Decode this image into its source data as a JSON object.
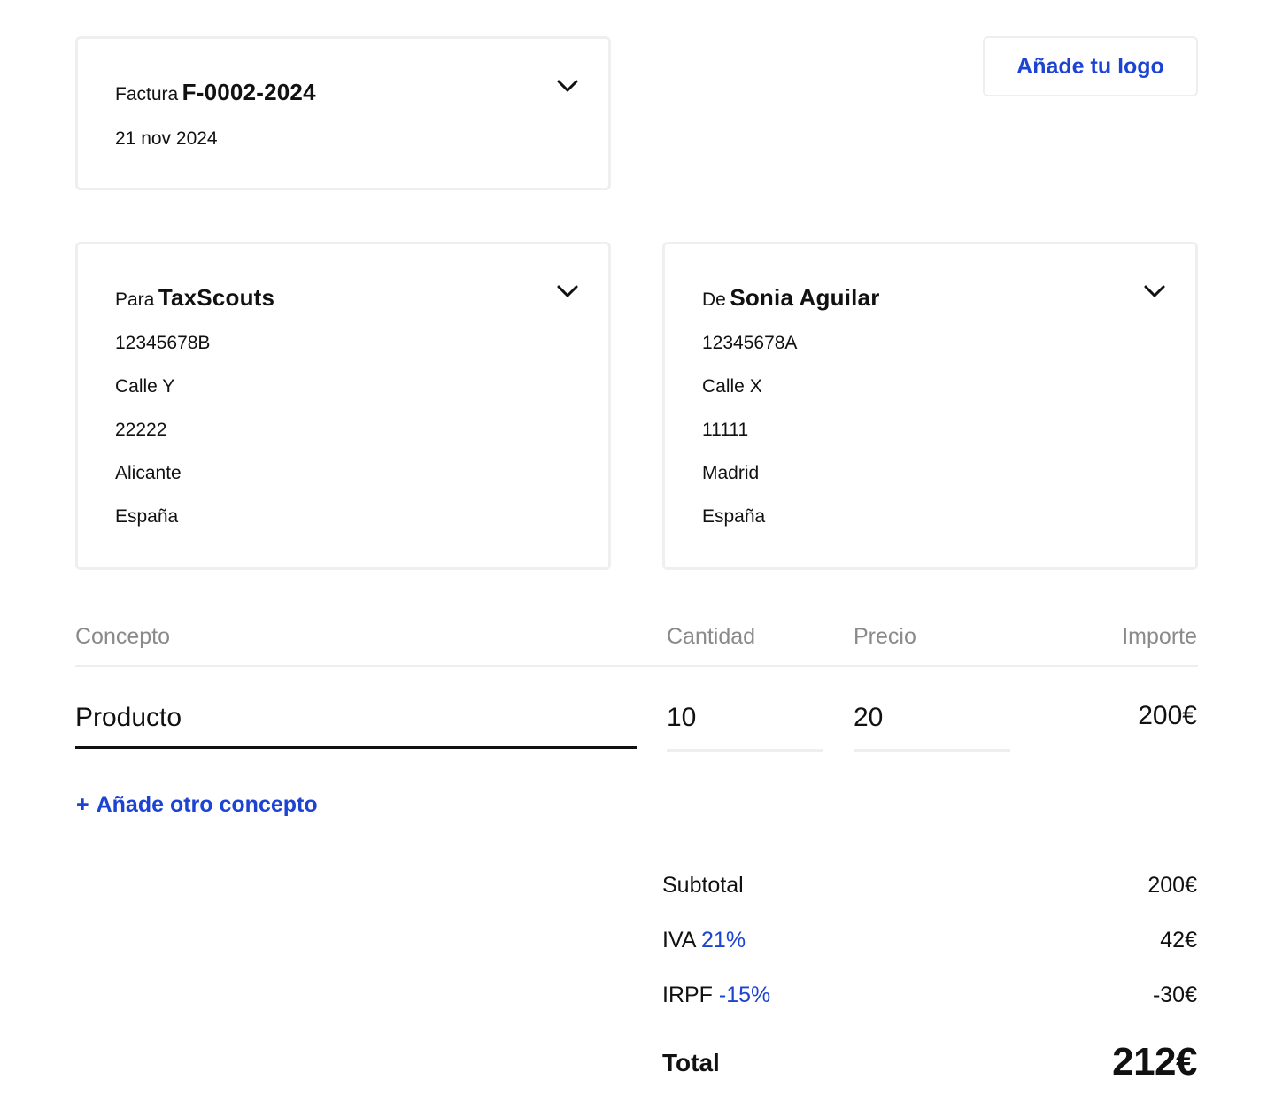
{
  "invoice": {
    "prefix": "Factura",
    "number": "F-0002-2024",
    "date": "21 nov 2024"
  },
  "logo": {
    "label": "Añade tu logo"
  },
  "client": {
    "prefix": "Para",
    "name": "TaxScouts",
    "fields": [
      "12345678B",
      "Calle Y",
      "22222",
      "Alicante",
      "España"
    ]
  },
  "sender": {
    "prefix": "De",
    "name": "Sonia Aguilar",
    "fields": [
      "12345678A",
      "Calle X",
      "11111",
      "Madrid",
      "España"
    ]
  },
  "table": {
    "headers": {
      "concept": "Concepto",
      "quantity": "Cantidad",
      "price": "Precio",
      "amount": "Importe"
    },
    "rows": [
      {
        "concept": "Producto",
        "quantity": "10",
        "price": "20",
        "amount": "200€"
      }
    ]
  },
  "add_line": {
    "plus": "+",
    "label": "Añade otro concepto"
  },
  "totals": {
    "subtotal_label": "Subtotal",
    "subtotal_value": "200€",
    "iva_label": "IVA",
    "iva_rate": "21%",
    "iva_value": "42€",
    "irpf_label": "IRPF",
    "irpf_rate": "-15%",
    "irpf_value": "-30€",
    "total_label": "Total",
    "total_value": "212€"
  },
  "colors": {
    "accent": "#1d43d3",
    "border": "#efefef",
    "muted": "#8a8a8a"
  }
}
